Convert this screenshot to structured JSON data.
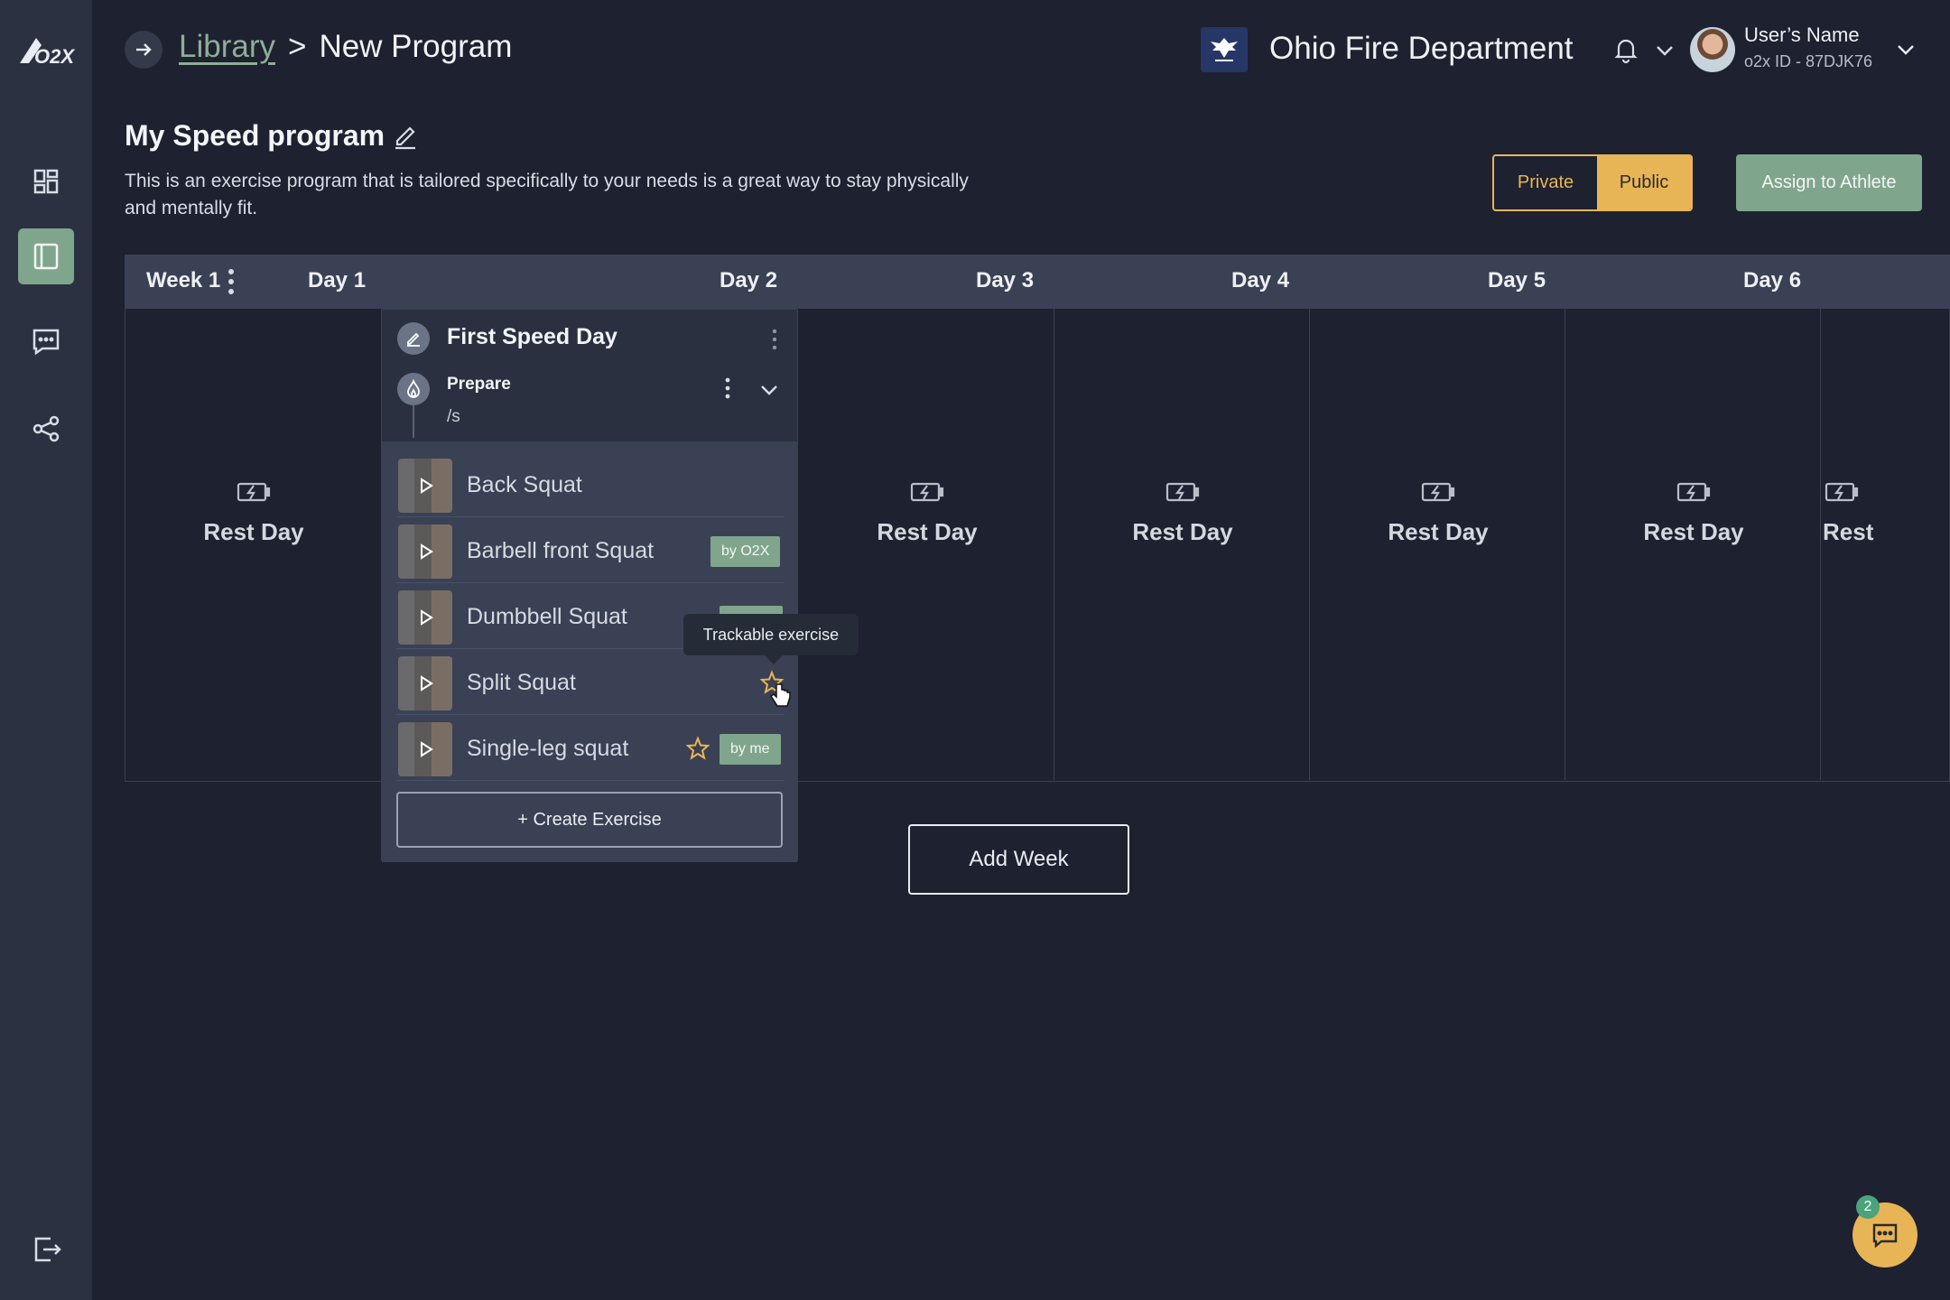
{
  "breadcrumb": {
    "parent": "Library",
    "separator": ">",
    "current": "New Program"
  },
  "org": {
    "name": "Ohio Fire Department"
  },
  "user": {
    "name": "User’s Name",
    "id": "o2x ID - 87DJK76"
  },
  "program": {
    "title": "My Speed program",
    "description": "This is an exercise program that is tailored specifically to your needs is a great way to stay physically and mentally fit."
  },
  "visibility": {
    "private_label": "Private",
    "public_label": "Public",
    "selected": "Public"
  },
  "assign_label": "Assign to Athlete",
  "week": {
    "label": "Week 1",
    "days": [
      "Day 1",
      "Day 2",
      "Day 3",
      "Day 4",
      "Day 5",
      "Day 6"
    ],
    "rest_label": "Rest Day",
    "rest_day_cutoff": "Rest"
  },
  "session": {
    "title": "First Speed Day",
    "block_title": "Prepare",
    "block_sub": "/s",
    "exercises": [
      {
        "name": "Back Squat",
        "badge": "",
        "star": false
      },
      {
        "name": "Barbell front Squat",
        "badge": "by O2X",
        "star": false
      },
      {
        "name": "Dumbbell Squat",
        "badge": "",
        "star": false
      },
      {
        "name": "Split Squat",
        "badge": "",
        "star": true
      },
      {
        "name": "Single-leg squat",
        "badge": "by me",
        "star": true
      }
    ],
    "create_label": "+ Create Exercise"
  },
  "tooltip": "Trackable exercise",
  "add_week_label": "Add Week",
  "chat": {
    "badge_count": "2"
  },
  "colors": {
    "accent_green": "#80a58d",
    "accent_gold": "#e8b556",
    "background": "#1d2130",
    "sidebar": "#2b3140"
  },
  "icons": [
    "o2x-logo",
    "dashboard-icon",
    "library-icon",
    "messages-icon",
    "share-icon",
    "logout-icon",
    "arrow-right-icon",
    "bell-icon",
    "chevron-down-icon",
    "pencil-icon",
    "kebab-icon",
    "flame-icon",
    "play-icon",
    "star-icon",
    "battery-charging-icon",
    "chat-icon"
  ]
}
